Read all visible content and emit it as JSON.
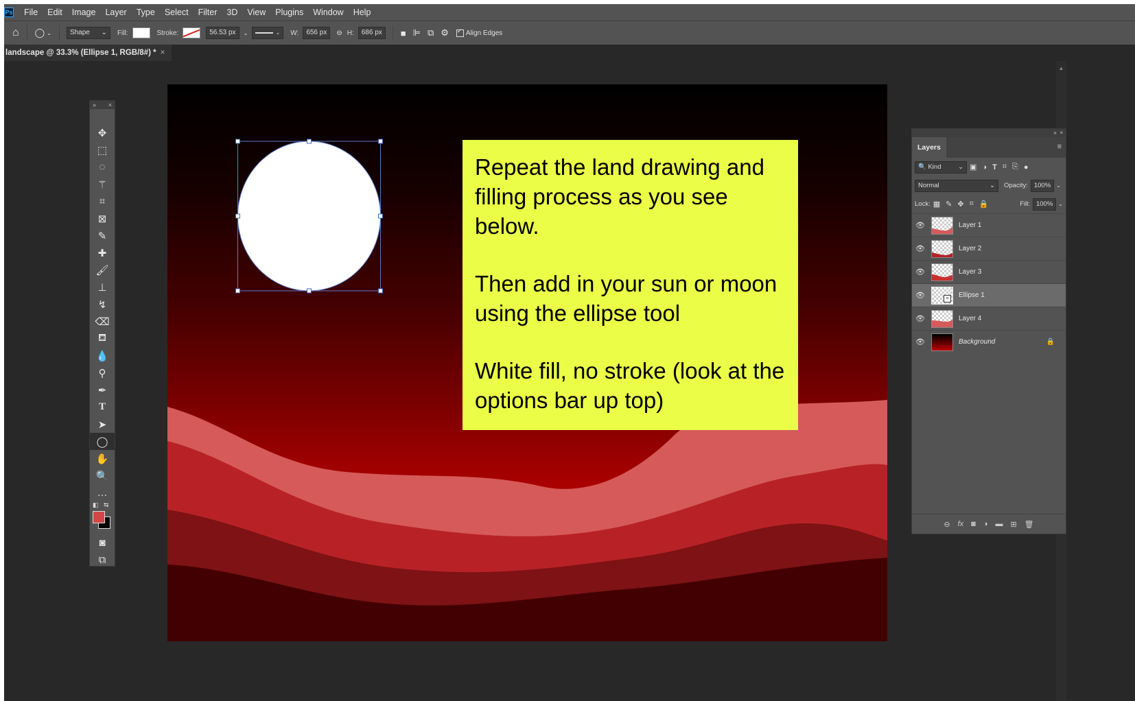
{
  "app": {
    "logo": "Ps"
  },
  "menu": [
    "File",
    "Edit",
    "Image",
    "Layer",
    "Type",
    "Select",
    "Filter",
    "3D",
    "View",
    "Plugins",
    "Window",
    "Help"
  ],
  "options": {
    "mode": "Shape",
    "fill_label": "Fill:",
    "stroke_label": "Stroke:",
    "stroke_width": "56.53 px",
    "w_label": "W:",
    "w_value": "656 px",
    "h_label": "H:",
    "h_value": "686 px",
    "align_edges": "Align Edges"
  },
  "document": {
    "tab_title": "landscape @ 33.3% (Ellipse 1, RGB/8#) *",
    "close": "×"
  },
  "note": {
    "lines": [
      "Repeat the land drawing and filling process as you see below.",
      "Then add in your sun or moon using the ellipse tool",
      "White fill, no stroke (look at the options bar up top)"
    ]
  },
  "layers_panel": {
    "tab": "Layers",
    "filter_kind": "Kind",
    "blend_mode": "Normal",
    "opacity_label": "Opacity:",
    "opacity_value": "100%",
    "lock_label": "Lock:",
    "fill_label": "Fill:",
    "fill_value": "100%",
    "layers": [
      {
        "name": "Layer 1",
        "thumb": "land",
        "selected": false
      },
      {
        "name": "Layer 2",
        "thumb": "land",
        "selected": false
      },
      {
        "name": "Layer 3",
        "thumb": "land",
        "selected": false
      },
      {
        "name": "Ellipse 1",
        "thumb": "shape",
        "selected": true
      },
      {
        "name": "Layer 4",
        "thumb": "land",
        "selected": false
      },
      {
        "name": "Background",
        "thumb": "gradient",
        "selected": false,
        "locked": true
      }
    ]
  },
  "colors": {
    "foreground": "#d44646",
    "background": "#000000",
    "note_bg": "#ebfd47",
    "sun": "#ffffff"
  }
}
